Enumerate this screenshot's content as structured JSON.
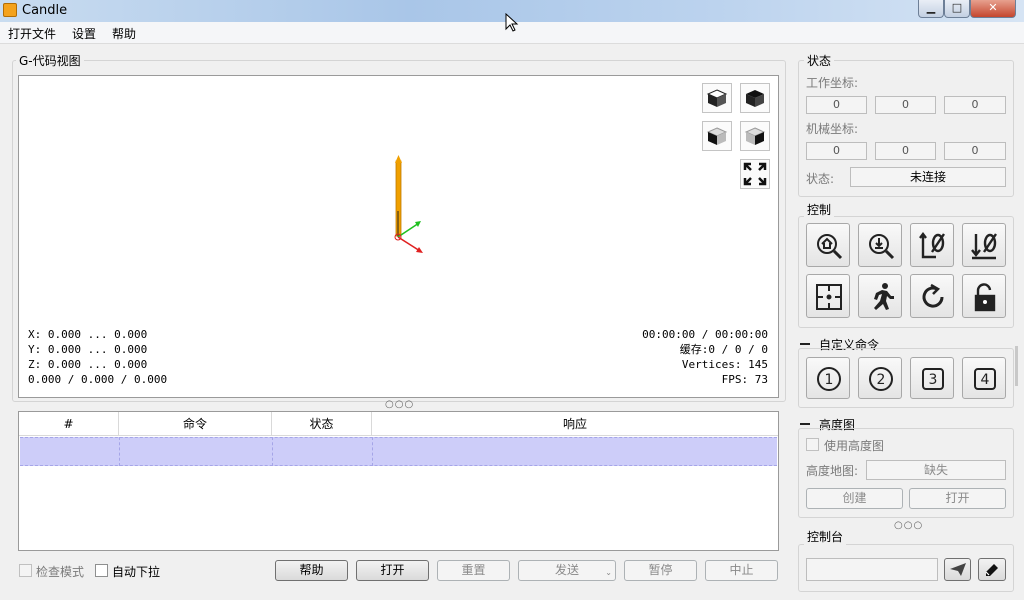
{
  "window": {
    "title": "Candle"
  },
  "menu": {
    "items": [
      "打开文件",
      "设置",
      "帮助"
    ]
  },
  "gcode_view": {
    "title": "G-代码视图",
    "info_left": [
      "X: 0.000 ... 0.000",
      "Y: 0.000 ... 0.000",
      "Z: 0.000 ... 0.000",
      "0.000 / 0.000 / 0.000"
    ],
    "info_right": [
      "00:00:00 / 00:00:00",
      "缓存:0 / 0 / 0",
      "Vertices: 145",
      "FPS: 73"
    ],
    "view_buttons": [
      "cube-iso-icon",
      "cube-top-icon",
      "cube-front-icon",
      "cube-left-icon",
      "fit-view-icon"
    ]
  },
  "table": {
    "headers": [
      "#",
      "命令",
      "状态",
      "响应"
    ]
  },
  "bottom": {
    "check_mode": "检查模式",
    "auto_scroll": "自动下拉",
    "buttons": {
      "help": "帮助",
      "open": "打开",
      "reset": "重置",
      "send": "发送",
      "pause": "暂停",
      "stop": "中止"
    }
  },
  "status": {
    "title": "状态",
    "work_label": "工作坐标:",
    "work": [
      "0",
      "0",
      "0"
    ],
    "machine_label": "机械坐标:",
    "machine": [
      "0",
      "0",
      "0"
    ],
    "state_label": "状态:",
    "state_value": "未连接"
  },
  "control": {
    "title": "控制",
    "buttons": [
      "home-icon",
      "probe-z-icon",
      "zero-xy-icon",
      "zero-z-icon",
      "return-origin-icon",
      "run-icon",
      "reset-icon",
      "unlock-icon"
    ]
  },
  "user_commands": {
    "title": "自定义命令",
    "buttons": [
      "1",
      "2",
      "3",
      "4"
    ]
  },
  "heightmap": {
    "title": "高度图",
    "use_label": "使用高度图",
    "map_label": "高度地图:",
    "map_value": "缺失",
    "create": "创建",
    "open": "打开"
  },
  "console": {
    "title": "控制台",
    "input_value": ""
  },
  "colors": {
    "selection": "#cdcdf9",
    "toolpath": "#f0a000",
    "axis_x": "#e02020",
    "axis_y": "#20c020"
  }
}
